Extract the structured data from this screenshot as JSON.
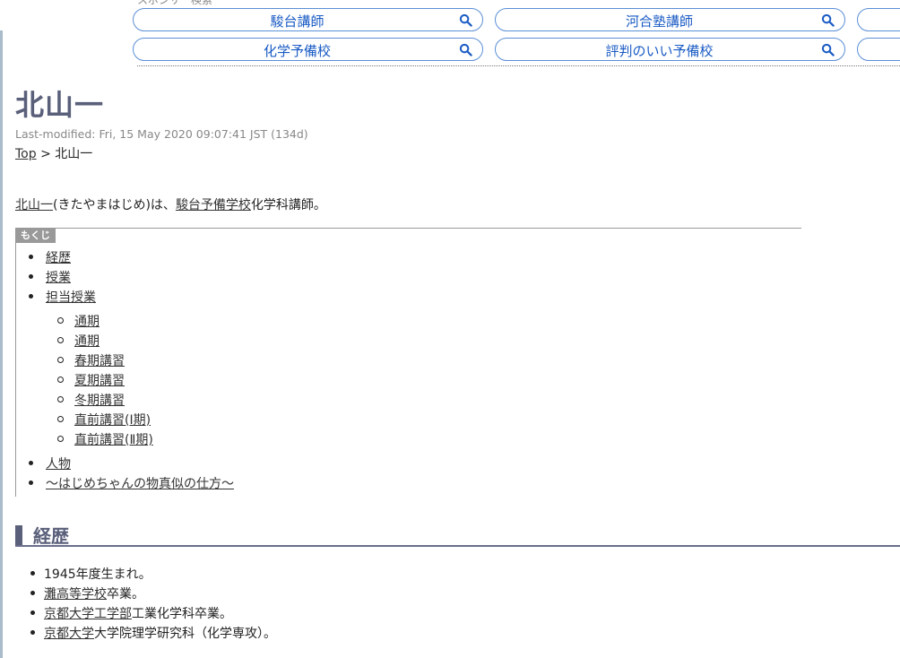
{
  "ads": {
    "label": "スポンサー検索",
    "pills": [
      "駿台講師",
      "河合塾講師",
      "化学予備校",
      "評判のいい予備校"
    ]
  },
  "page": {
    "title": "北山一",
    "last_modified": "Last-modified: Fri, 15 May 2020 09:07:41 JST (134d)"
  },
  "breadcrumb": {
    "top": "Top",
    "sep": ">",
    "current": "北山一"
  },
  "intro": {
    "name_link": "北山一",
    "reading": "(きたやまはじめ)は、",
    "school_link": "駿台予備学校",
    "rest": "化学科講師。"
  },
  "toc": {
    "label": "もくじ",
    "items": [
      "経歴",
      "授業",
      "担当授業"
    ],
    "subitems": [
      "通期",
      "通期",
      "春期講習",
      "夏期講習",
      "冬期講習",
      "直前講習(Ⅰ期)",
      "直前講習(Ⅱ期)"
    ],
    "items2": [
      "人物",
      "～はじめちゃんの物真似の仕方～"
    ]
  },
  "history": {
    "heading": "経歴",
    "items": [
      {
        "text": "1945年度生まれ。"
      },
      {
        "link": "灘高等学校",
        "text": "卒業。"
      },
      {
        "link": "京都大学工学部",
        "text": "工業化学科卒業。"
      },
      {
        "link": "京都大学",
        "text": "大学院理学研究科（化学専攻）。"
      }
    ]
  }
}
